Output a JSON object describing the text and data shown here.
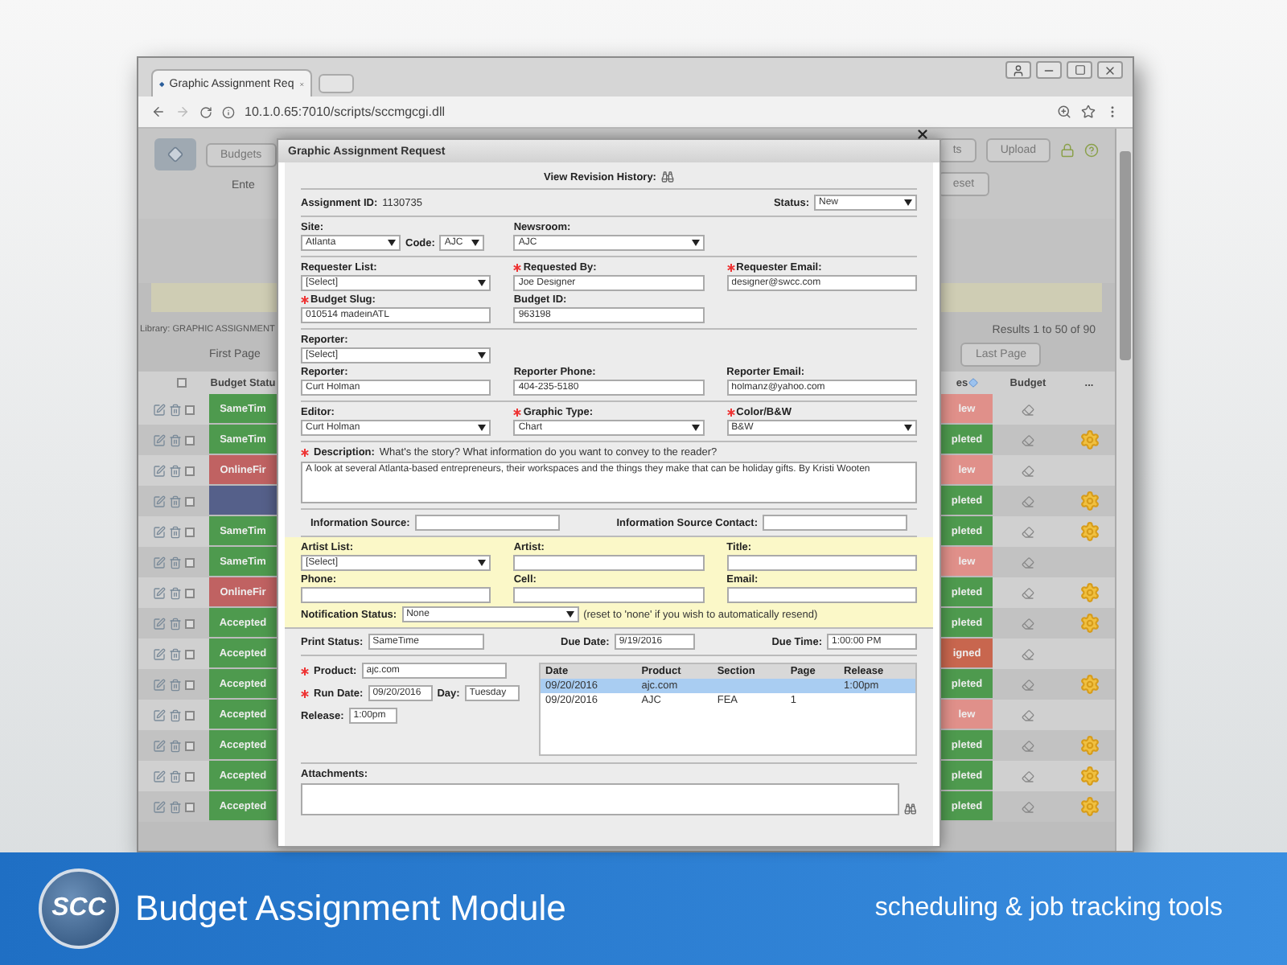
{
  "browser": {
    "tab_title": "Graphic Assignment Req",
    "url": "10.1.0.65:7010/scripts/sccmgcgi.dll"
  },
  "app": {
    "left_buttons": [
      "Budgets"
    ],
    "enter_text": "Ente",
    "right_buttons": [
      "ts",
      "Upload"
    ],
    "reset_button": "eset",
    "library": "Library: GRAPHIC ASSIGNMENT",
    "first_page": "First Page",
    "results": "Results 1 to 50 of 90",
    "last_page": "Last Page",
    "header_checked": false,
    "columns": {
      "status_left": "Budget Statu",
      "status_right": "es",
      "budget": "Budget",
      "more": "..."
    },
    "rows": [
      {
        "checked": false,
        "left": {
          "status": "SameTim",
          "color": "#4e9a4e"
        },
        "right": {
          "status": "lew",
          "color": "#e0908a"
        },
        "gear": false
      },
      {
        "checked": false,
        "left": {
          "status": "SameTim",
          "color": "#4e9a4e"
        },
        "right": {
          "status": "pleted",
          "color": "#4e9a4e"
        },
        "gear": true
      },
      {
        "checked": false,
        "left": {
          "status": "OnlineFir",
          "color": "#c06262"
        },
        "right": {
          "status": "lew",
          "color": "#e0908a"
        },
        "gear": false
      },
      {
        "checked": false,
        "left": {
          "color": "#55608a"
        },
        "right": {
          "status": "pleted",
          "color": "#4e9a4e"
        },
        "gear": true
      },
      {
        "checked": false,
        "left": {
          "status": "SameTim",
          "color": "#4e9a4e"
        },
        "right": {
          "status": "pleted",
          "color": "#4e9a4e"
        },
        "gear": true
      },
      {
        "checked": false,
        "left": {
          "status": "SameTim",
          "color": "#4e9a4e"
        },
        "right": {
          "status": "lew",
          "color": "#e0908a"
        },
        "gear": false
      },
      {
        "checked": false,
        "left": {
          "status": "OnlineFir",
          "color": "#c06262"
        },
        "right": {
          "status": "pleted",
          "color": "#4e9a4e"
        },
        "gear": true
      },
      {
        "checked": false,
        "left": {
          "status": "Accepted",
          "color": "#4e9a4e"
        },
        "right": {
          "status": "pleted",
          "color": "#4e9a4e"
        },
        "gear": true
      },
      {
        "checked": false,
        "left": {
          "status": "Accepted",
          "color": "#4e9a4e"
        },
        "right": {
          "status": "igned",
          "color": "#c8664e"
        },
        "gear": false
      },
      {
        "checked": false,
        "left": {
          "status": "Accepted",
          "color": "#4e9a4e"
        },
        "right": {
          "status": "pleted",
          "color": "#4e9a4e"
        },
        "gear": true
      },
      {
        "checked": false,
        "left": {
          "status": "Accepted",
          "color": "#4e9a4e"
        },
        "right": {
          "status": "lew",
          "color": "#e0908a"
        },
        "gear": false
      },
      {
        "checked": false,
        "left": {
          "status": "Accepted",
          "color": "#4e9a4e"
        },
        "right": {
          "status": "pleted",
          "color": "#4e9a4e"
        },
        "gear": true
      },
      {
        "checked": false,
        "left": {
          "status": "Accepted",
          "color": "#4e9a4e"
        },
        "right": {
          "status": "pleted",
          "color": "#4e9a4e"
        },
        "gear": true
      },
      {
        "checked": false,
        "left": {
          "status": "Accepted",
          "color": "#4e9a4e"
        },
        "right": {
          "status": "pleted",
          "color": "#4e9a4e"
        },
        "gear": true
      }
    ]
  },
  "modal": {
    "title": "Graphic Assignment Request",
    "revision_label": "View Revision History:",
    "assignment_label": "Assignment ID:",
    "assignment_id": "1130735",
    "status": {
      "label": "Status:",
      "value": "New"
    },
    "site": {
      "label": "Site:",
      "value": "Atlanta"
    },
    "code": {
      "label": "Code:",
      "value": "AJC"
    },
    "newsroom": {
      "label": "Newsroom:",
      "value": "AJC"
    },
    "sections": [
      {
        "rows": [
          [
            {
              "label": "Requester List:",
              "required": false,
              "kind": "select",
              "value": "[Select]"
            },
            {
              "label": "Requested By:",
              "required": true,
              "kind": "input",
              "value": "Joe Designer"
            },
            {
              "label": "Requester Email:",
              "required": true,
              "kind": "input",
              "value": "designer@swcc.com"
            }
          ],
          [
            {
              "label": "Budget Slug:",
              "required": true,
              "kind": "input",
              "value": "010514 madeinATL"
            },
            {
              "label": "Budget ID:",
              "required": false,
              "kind": "input",
              "value": "963198"
            }
          ]
        ]
      },
      {
        "rows": [
          [
            {
              "label": "Reporter:",
              "required": false,
              "kind": "select",
              "value": "[Select]"
            }
          ],
          [
            {
              "label": "Reporter:",
              "required": false,
              "kind": "input",
              "value": "Curt Holman"
            },
            {
              "label": "Reporter Phone:",
              "required": false,
              "kind": "input",
              "value": "404-235-5180"
            },
            {
              "label": "Reporter Email:",
              "required": false,
              "kind": "input",
              "value": "holmanz@yahoo.com"
            }
          ]
        ]
      },
      {
        "rows": [
          [
            {
              "label": "Editor:",
              "required": false,
              "kind": "select",
              "value": "Curt Holman"
            },
            {
              "label": "Graphic Type:",
              "required": true,
              "kind": "select",
              "value": "Chart"
            },
            {
              "label": "Color/B&W",
              "required": true,
              "kind": "select",
              "value": "B&W"
            }
          ]
        ]
      }
    ],
    "description": {
      "label": "Description:",
      "required": true,
      "hint": "What's the story? What information do you want to convey to the reader?",
      "value": "A look at several Atlanta-based entrepreneurs, their workspaces and the things they make that can be holiday gifts. By Kristi Wooten"
    },
    "info_sources": [
      {
        "label": "Information Source:"
      },
      {
        "label": "Information Source Contact:"
      }
    ],
    "artist_rows": [
      [
        {
          "label": "Artist List:",
          "required": false,
          "kind": "select",
          "value": "[Select]"
        },
        {
          "label": "Artist:",
          "required": false,
          "kind": "input"
        },
        {
          "label": "Title:",
          "required": false,
          "kind": "input"
        }
      ],
      [
        {
          "label": "Phone:",
          "required": false,
          "kind": "input"
        },
        {
          "label": "Cell:",
          "required": false,
          "kind": "input"
        },
        {
          "label": "Email:",
          "required": false,
          "kind": "input"
        }
      ]
    ],
    "notification": {
      "label": "Notification Status:",
      "value": "None",
      "note": "(reset to 'none' if you wish to automatically resend)"
    },
    "print_row": [
      {
        "label": "Print Status:",
        "required": false,
        "value": "SameTime"
      },
      {
        "label": "Due Date:",
        "required": false,
        "value": "9/19/2016"
      },
      {
        "label": "Due Time:",
        "required": false,
        "value": "1:00:00 PM"
      }
    ],
    "run_fields": [
      {
        "label": "Product:",
        "required": true,
        "value": "ajc.com"
      },
      {
        "label": "Run Date:",
        "required": true,
        "value": "09/20/2016"
      },
      {
        "label": "Day:",
        "required": false,
        "value": "Tuesday"
      },
      {
        "label": "Release:",
        "required": false,
        "value": "1:00pm"
      }
    ],
    "run_table": {
      "columns": [
        "Date",
        "Product",
        "Section",
        "Page",
        "Release"
      ],
      "rows": [
        {
          "selected": true,
          "cells": [
            "09/20/2016",
            "ajc.com",
            "",
            "",
            "1:00pm"
          ]
        },
        {
          "selected": false,
          "cells": [
            "09/20/2016",
            "AJC",
            "FEA",
            "1",
            ""
          ]
        }
      ]
    },
    "attachments_label": "Attachments:"
  },
  "banner": {
    "logo_text": "SCC",
    "title": "Budget Assignment Module",
    "tagline": "scheduling & job tracking tools"
  }
}
